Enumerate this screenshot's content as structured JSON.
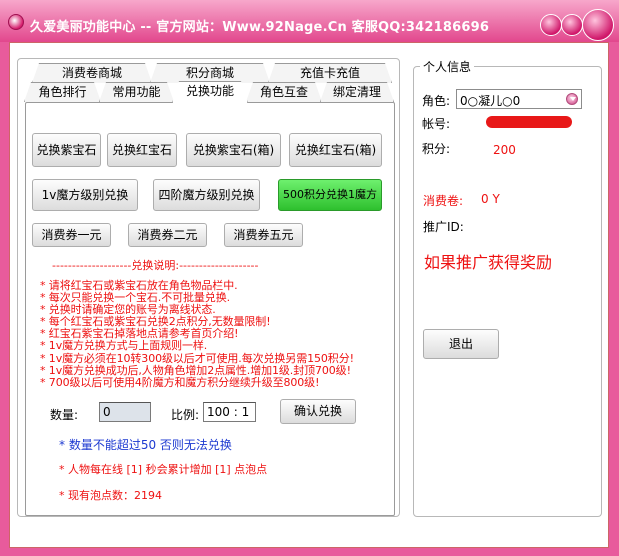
{
  "window": {
    "title": "久爱美丽功能中心 -- 官方网站：Www.92Nage.Cn 客服QQ:342186696"
  },
  "tabs": {
    "row_top": [
      "消费卷商城",
      "积分商城",
      "充值卡充值"
    ],
    "row_bottom": [
      "角色排行",
      "常用功能",
      "兑换功能",
      "角色互查",
      "绑定清理"
    ],
    "active": "兑换功能"
  },
  "exchange": {
    "buttons_row1": [
      "兑换紫宝石",
      "兑换红宝石",
      "兑换紫宝石(箱)",
      "兑换红宝石(箱)"
    ],
    "buttons_row2": [
      "1v魔方级别兑换",
      "四阶魔方级别兑换",
      "500积分兑换1魔方"
    ],
    "buttons_row3": [
      "消费券一元",
      "消费券二元",
      "消费券五元"
    ],
    "separator": "--------------------兑换说明:--------------------",
    "rules": [
      "* 请将红宝石或紫宝石放在角色物品栏中.",
      "* 每次只能兑换一个宝石.不可批量兑换.",
      "* 兑换时请确定您的账号为离线状态.",
      "* 每个红宝石或紫宝石兑换2点积分,无数量限制!",
      "* 红宝石紫宝石掉落地点请参考首页介绍!",
      "* 1v魔方兑换方式与上面规则一样.",
      "* 1v魔方必须在10转300级以后才可使用.每次兑换另需150积分!",
      "* 1v魔方兑换成功后,人物角色增加2点属性.增加1级.封顶700级!",
      "* 700级以后可使用4阶魔方和魔方积分继续升级至800级!"
    ],
    "quantity_label": "数量:",
    "quantity_value": "0",
    "ratio_label": "比例:",
    "ratio_value": "100 : 1",
    "confirm_label": "确认兑换",
    "note_blue": "* 数量不能超过50 否则无法兑换",
    "note_online": "* 人物每在线 [1] 秒会累计增加 [1] 点泡点",
    "note_points": "* 现有泡点数：2194"
  },
  "personal": {
    "group_title": "个人信息",
    "role_label": "角色:",
    "role_value": "0○凝儿○0",
    "account_label": "帐号:",
    "points_label": "积分:",
    "points_value": "200",
    "coupon_label": "消费卷:",
    "coupon_value": "0 Y",
    "promo_label": "推广ID:",
    "promo_text": "如果推广获得奖励",
    "exit_label": "退出"
  },
  "colors": {
    "accent_pink": "#e2478d",
    "rule_red": "#ee1111",
    "note_blue": "#1d3ad1",
    "highlight_green": "#2ec02e"
  },
  "icons": [
    "app-icon",
    "dropdown-arrow-icon",
    "minimize-icon",
    "maximize-icon",
    "close-icon"
  ]
}
